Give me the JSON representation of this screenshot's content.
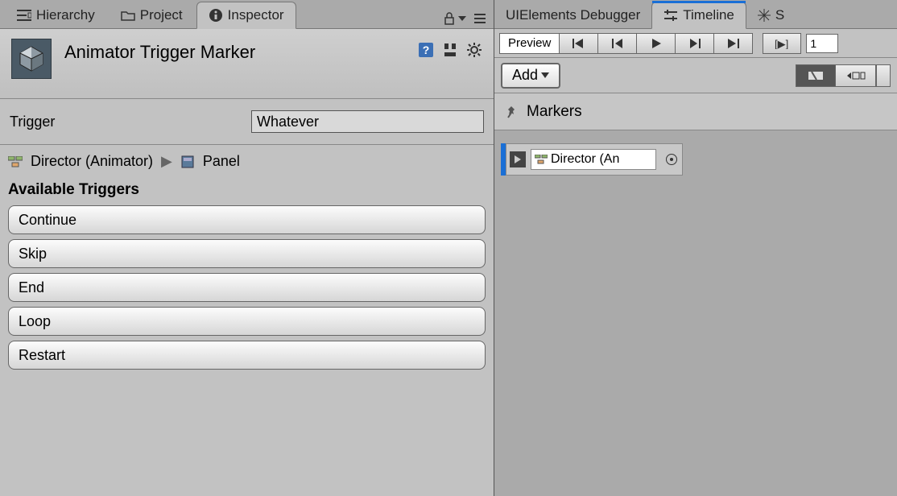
{
  "tabs_left": {
    "hierarchy": "Hierarchy",
    "project": "Project",
    "inspector": "Inspector"
  },
  "inspector": {
    "title": "Animator Trigger Marker",
    "trigger_label": "Trigger",
    "trigger_value": "Whatever",
    "path": {
      "director": "Director (Animator)",
      "panel": "Panel"
    },
    "available_title": "Available Triggers",
    "triggers": [
      "Continue",
      "Skip",
      "End",
      "Loop",
      "Restart"
    ]
  },
  "tabs_right": {
    "debugger": "UIElements Debugger",
    "timeline": "Timeline",
    "scene": "S"
  },
  "timeline": {
    "preview": "Preview",
    "frame": "1",
    "add": "Add",
    "markers": "Markers",
    "track_name": "Director (An"
  }
}
